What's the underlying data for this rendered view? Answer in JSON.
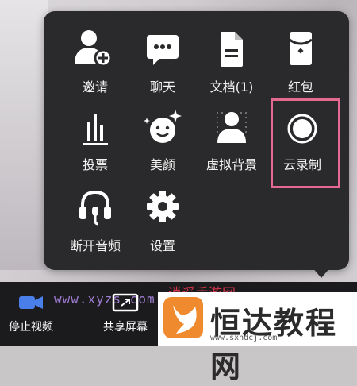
{
  "menu": {
    "items": [
      {
        "label": "邀请",
        "icon": "add-user-icon"
      },
      {
        "label": "聊天",
        "icon": "chat-icon"
      },
      {
        "label": "文档(1)",
        "icon": "document-icon"
      },
      {
        "label": "红包",
        "icon": "red-packet-icon"
      },
      {
        "label": "投票",
        "icon": "vote-icon"
      },
      {
        "label": "美颜",
        "icon": "beauty-icon"
      },
      {
        "label": "虚拟背景",
        "icon": "virtual-background-icon"
      },
      {
        "label": "云录制",
        "icon": "cloud-record-icon"
      },
      {
        "label": "断开音频",
        "icon": "headphones-icon"
      },
      {
        "label": "设置",
        "icon": "gear-icon"
      }
    ],
    "highlight_color": "#e46a92"
  },
  "bottom_bar": {
    "stop_video": "停止视频",
    "share_screen": "共享屏幕"
  },
  "watermarks": {
    "site": "www.xyzs.com",
    "site_name": "逍遥手游网"
  },
  "brand": {
    "name": "恒达教程网",
    "url": "www.sxhdcj.com",
    "accent": "#f08a2e"
  }
}
